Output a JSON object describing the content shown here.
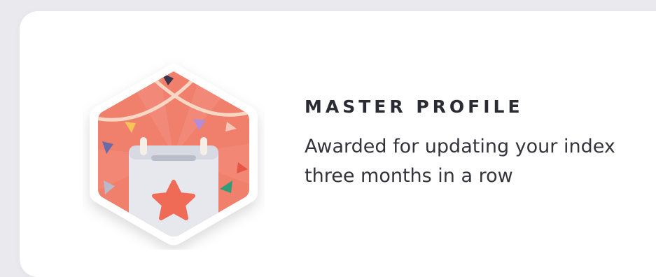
{
  "badge": {
    "title": "MASTER PROFILE",
    "description": "Awarded for updating your index three months in a row",
    "icon": "calendar-star-icon",
    "colors": {
      "background": "#f07f6c",
      "calendar": "#e6e8ee",
      "star": "#ef6b55",
      "border": "#ffffff"
    }
  }
}
